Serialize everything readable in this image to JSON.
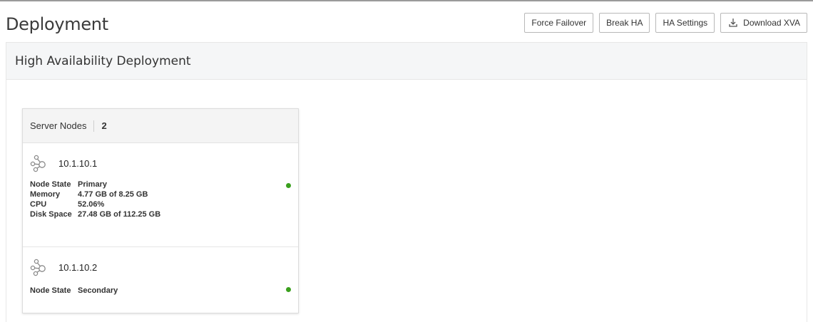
{
  "page": {
    "title": "Deployment"
  },
  "toolbar": {
    "force_failover": "Force Failover",
    "break_ha": "Break HA",
    "ha_settings": "HA Settings",
    "download_xva": "Download XVA"
  },
  "panel": {
    "title": "High Availability Deployment"
  },
  "server_nodes": {
    "label": "Server Nodes",
    "count": "2",
    "status_color": "#3aa01d",
    "nodes": [
      {
        "ip": "10.1.10.1",
        "icon": "cluster-node-icon",
        "props": [
          {
            "key": "Node State",
            "value": "Primary"
          },
          {
            "key": "Memory",
            "value": "4.77 GB of 8.25 GB"
          },
          {
            "key": "CPU",
            "value": "52.06%"
          },
          {
            "key": "Disk Space",
            "value": "27.48 GB of 112.25 GB"
          }
        ]
      },
      {
        "ip": "10.1.10.2",
        "icon": "cluster-node-icon",
        "props": [
          {
            "key": "Node State",
            "value": "Secondary"
          }
        ]
      }
    ]
  }
}
